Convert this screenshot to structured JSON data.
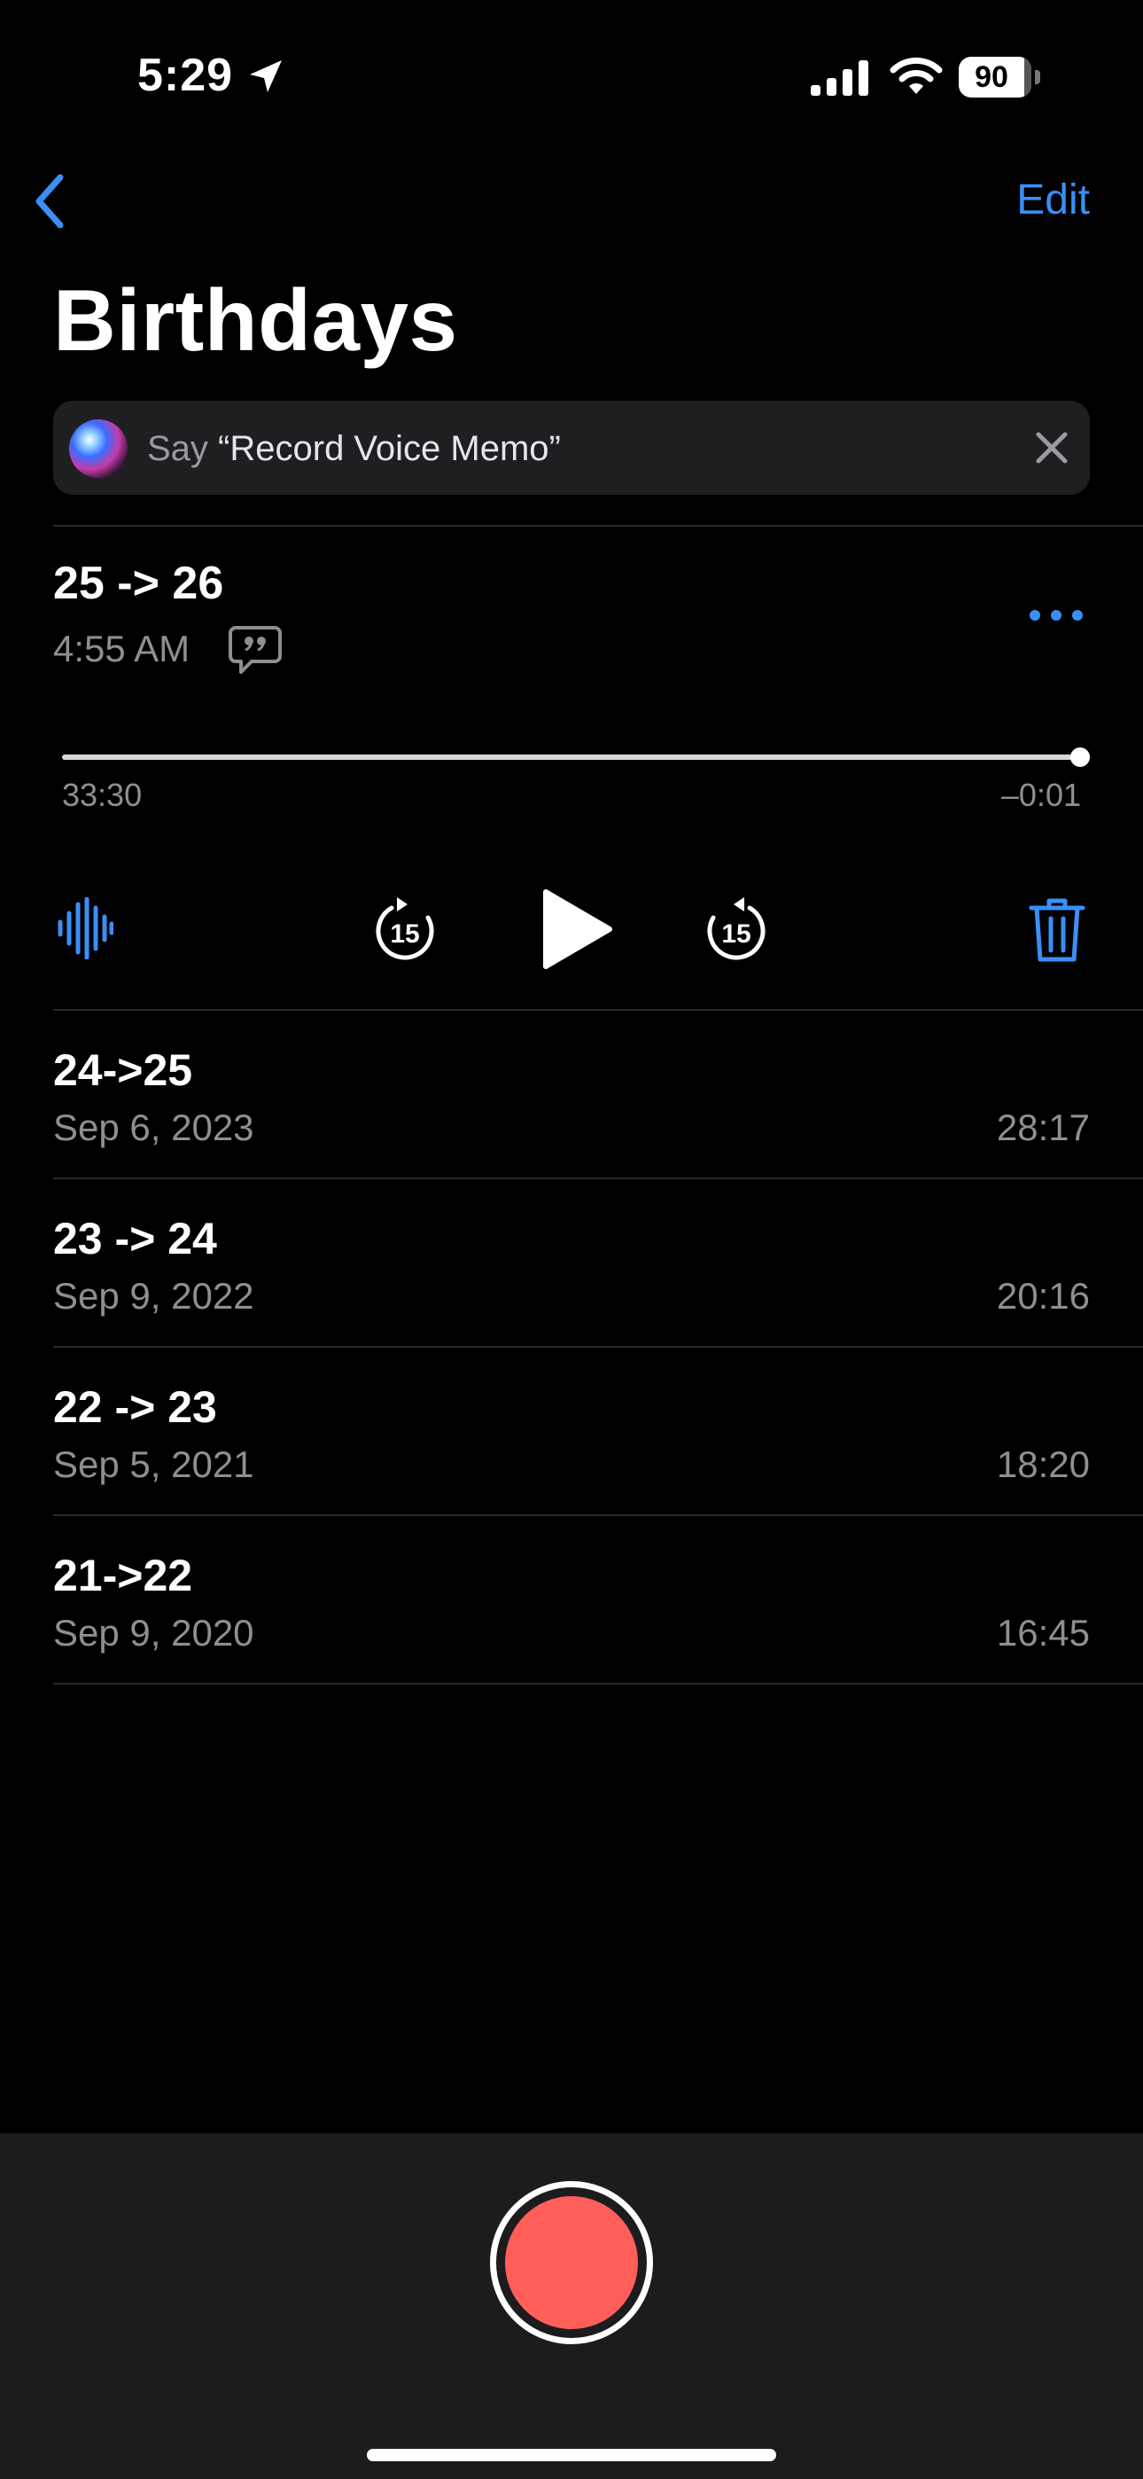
{
  "status_bar": {
    "time": "5:29",
    "battery": "90",
    "battery_level_percent": 90
  },
  "nav": {
    "back_label": "",
    "edit_label": "Edit",
    "title": "Birthdays"
  },
  "siri_banner": {
    "prefix": "Say ",
    "phrase": "“Record Voice Memo”"
  },
  "expanded_memo": {
    "title": "25 -> 26",
    "time": "4:55 AM",
    "elapsed": "33:30",
    "remaining": "–0:01",
    "progress_fraction": 0.9995
  },
  "recordings": [
    {
      "name": "24->25",
      "date": "Sep 6, 2023",
      "duration": "28:17"
    },
    {
      "name": "23 -> 24",
      "date": "Sep 9, 2022",
      "duration": "20:16"
    },
    {
      "name": "22 -> 23",
      "date": "Sep 5, 2021",
      "duration": "18:20"
    },
    {
      "name": "21->22",
      "date": "Sep 9, 2020",
      "duration": "16:45"
    }
  ],
  "icons": {
    "location": "location-arrow-icon",
    "signal": "cellular-signal-icon",
    "wifi": "wifi-icon",
    "back": "chevron-left-icon",
    "siri": "siri-orb-icon",
    "close": "close-icon",
    "transcript": "transcript-bubble-icon",
    "more": "ellipsis-icon",
    "waveform": "waveform-icon",
    "skip_back": "skip-back-15-icon",
    "play": "play-icon",
    "skip_forward": "skip-forward-15-icon",
    "trash": "trash-icon",
    "record": "record-icon"
  },
  "colors": {
    "accent": "#3a8ff7",
    "record": "#ff5f58",
    "background": "#000000",
    "secondary_text": "#8e8e93"
  }
}
